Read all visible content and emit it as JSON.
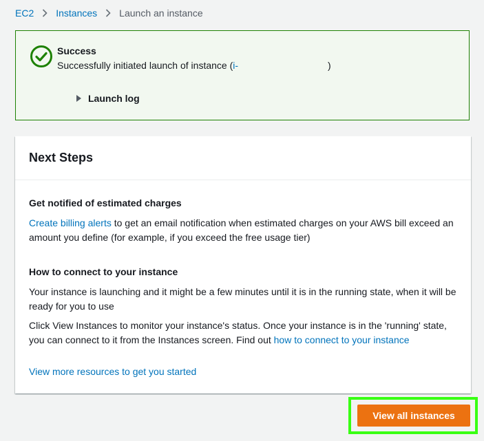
{
  "breadcrumb": {
    "items": [
      {
        "label": "EC2"
      },
      {
        "label": "Instances"
      },
      {
        "label": "Launch an instance"
      }
    ]
  },
  "alert": {
    "type": "success",
    "color": "#1d8102",
    "title": "Success",
    "message_prefix": "Successfully initiated launch of instance (",
    "instance_id": "i-",
    "message_suffix": ")",
    "launch_log_label": "Launch log"
  },
  "next_steps": {
    "title": "Next Steps",
    "billing": {
      "title": "Get notified of estimated charges",
      "link": "Create billing alerts",
      "text": " to get an email notification when estimated charges on your AWS bill exceed an amount you define (for example, if you exceed the free usage tier)"
    },
    "connect": {
      "title": "How to connect to your instance",
      "para1": "Your instance is launching and it might be a few minutes until it is in the running state, when it will be ready for you to use",
      "para2": "Click View Instances to monitor your instance's status. Once your instance is in the 'running' state, you can connect to it from the Instances screen. Find out ",
      "para2_link": "how to connect to your instance"
    },
    "resources_link": "View more resources to get you started"
  },
  "actions": {
    "view_all_label": "View all instances",
    "accent_color": "#ec7211"
  }
}
